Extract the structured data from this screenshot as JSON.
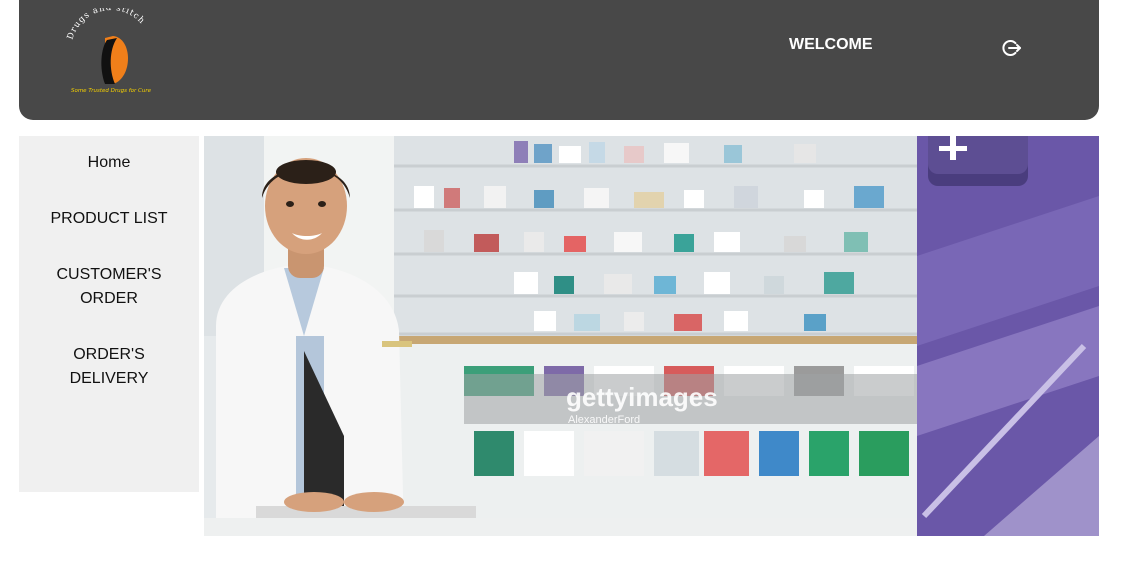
{
  "header": {
    "logo": {
      "brand_text": "Drugs and stitch",
      "tagline": "Some Trusted Drugs for Cure"
    },
    "welcome": "WELCOME",
    "logout_icon": "logout-icon"
  },
  "sidebar": {
    "items": [
      {
        "label": "Home"
      },
      {
        "label": "PRODUCT LIST"
      },
      {
        "label": "CUSTOMER'S ORDER"
      },
      {
        "label": "ORDER'S DELIVERY"
      }
    ]
  },
  "banner": {
    "watermark": "gettyimages",
    "credit": "AlexanderFord"
  },
  "colors": {
    "header_bg": "#484848",
    "sidebar_bg": "#f0f0f0",
    "logo_orange": "#f07f1a",
    "logo_yellow": "#f5d000",
    "keyboard_purple": "#6a57a8"
  }
}
